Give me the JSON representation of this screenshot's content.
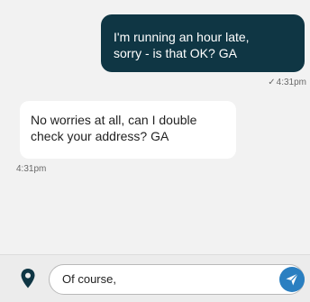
{
  "messages": {
    "outgoing": {
      "line1": "I'm running an hour late,",
      "line2": "sorry - is that OK? GA",
      "status_icon": "check-icon",
      "time": "4:31pm"
    },
    "incoming": {
      "line1": "No worries at all, can I double",
      "line2": "check your address? GA",
      "time": "4:31pm"
    }
  },
  "composer": {
    "location_icon": "location-pin-icon",
    "input_value": "Of course,",
    "send_icon": "send-icon"
  },
  "colors": {
    "outgoing_bubble": "#0f3644",
    "incoming_bubble": "#ffffff",
    "background": "#f2f2f2",
    "send_button": "#2a7fc1"
  }
}
